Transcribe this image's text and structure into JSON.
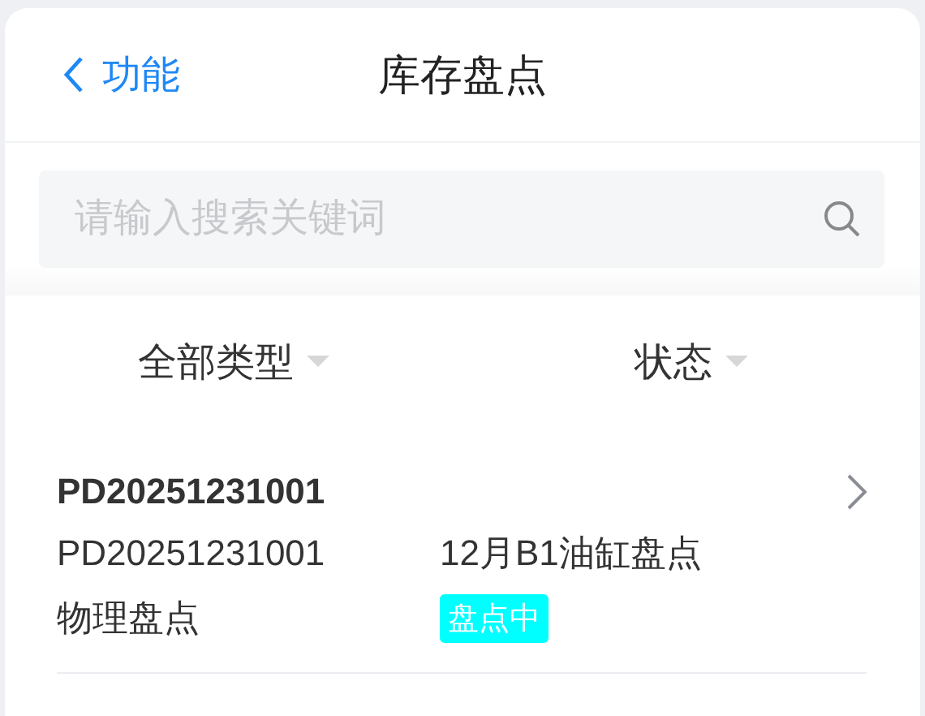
{
  "nav_bar": {
    "back_label": "功能",
    "title": "库存盘点"
  },
  "search": {
    "placeholder": "请输入搜索关键词"
  },
  "filters": [
    {
      "label": "全部类型"
    },
    {
      "label": "状态"
    }
  ],
  "records": [
    {
      "title": "PD20251231001",
      "code": "PD20251231001",
      "name": "12月B1油缸盘点",
      "type": "物理盘点",
      "status": "盘点中",
      "color": "#00ffff"
    }
  ]
}
